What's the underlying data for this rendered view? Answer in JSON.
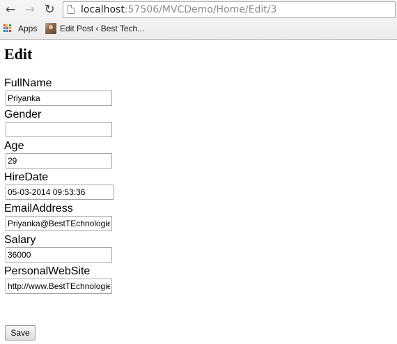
{
  "browser": {
    "url_host": "localhost",
    "url_path": ":57506/MVCDemo/Home/Edit/3",
    "bookmarks": [
      {
        "label": "Apps",
        "icon": "apps-grid-icon"
      },
      {
        "label": "Edit Post ‹ Best Tech...",
        "icon": "avatar-favicon"
      }
    ]
  },
  "page": {
    "title": "Edit",
    "fields": [
      {
        "label": "FullName",
        "value": "Priyanka"
      },
      {
        "label": "Gender",
        "value": ""
      },
      {
        "label": "Age",
        "value": "29"
      },
      {
        "label": "HireDate",
        "value": "05-03-2014 09:53:36"
      },
      {
        "label": "EmailAddress",
        "value": "Priyanka@BestTEchnologies.com"
      },
      {
        "label": "Salary",
        "value": "36000"
      },
      {
        "label": "PersonalWebSite",
        "value": "http://www.BestTEchnologies.com"
      }
    ],
    "save_label": "Save"
  },
  "icons": {
    "back": "back-arrow-icon",
    "forward": "forward-arrow-icon",
    "reload": "reload-icon",
    "page": "page-icon"
  },
  "colors": {
    "apps_grid": [
      "#db4437",
      "#f4b400",
      "#0f9d58",
      "#4285f4"
    ]
  }
}
